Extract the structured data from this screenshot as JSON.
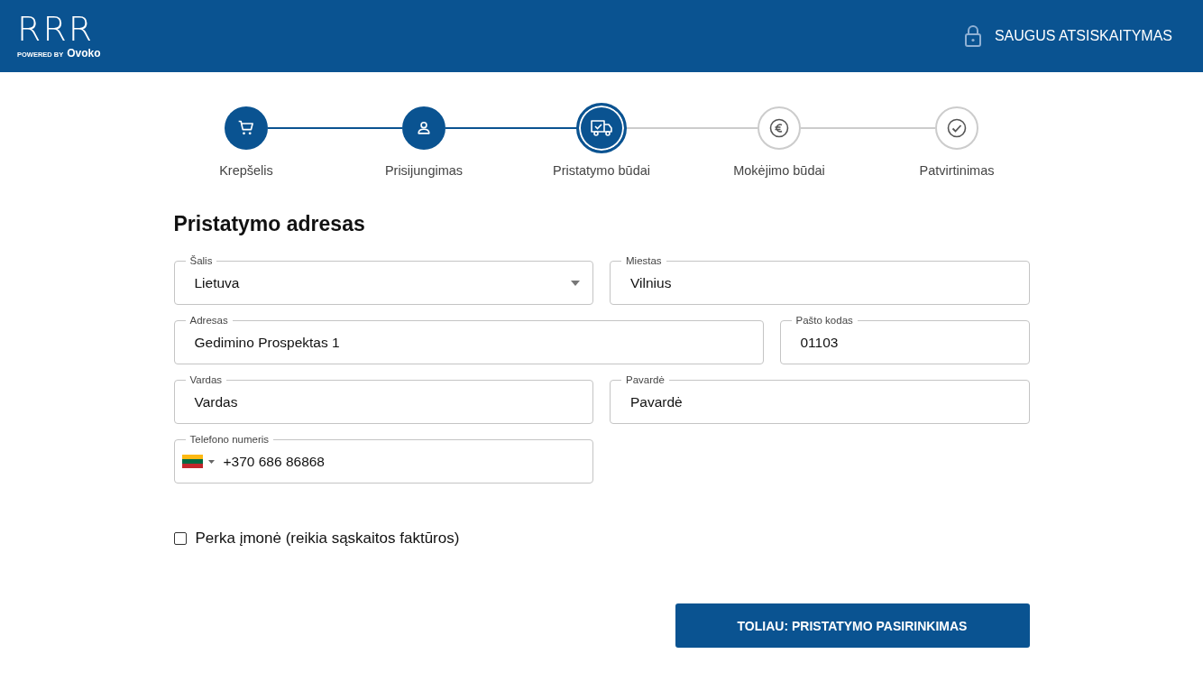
{
  "header": {
    "logo": "RRR",
    "powered_by": "POWERED BY",
    "brand": "Ovoko",
    "secure_label": "SAUGUS ATSISKAITYMAS"
  },
  "steps": [
    {
      "label": "Krepšelis",
      "kind": "done"
    },
    {
      "label": "Prisijungimas",
      "kind": "done"
    },
    {
      "label": "Pristatymo būdai",
      "kind": "current"
    },
    {
      "label": "Mokėjimo būdai",
      "kind": "todo"
    },
    {
      "label": "Patvirtinimas",
      "kind": "todo"
    }
  ],
  "form": {
    "title": "Pristatymo adresas",
    "rows": [
      [
        {
          "kind": "select",
          "label": "Šalis",
          "value": "Lietuva"
        },
        {
          "kind": "text",
          "label": "Miestas",
          "value": "Vilnius"
        }
      ],
      [
        {
          "kind": "text",
          "label": "Adresas",
          "value": "Gedimino Prospektas 1"
        },
        {
          "kind": "text",
          "label": "Pašto kodas",
          "value": "01103"
        }
      ],
      [
        {
          "kind": "text",
          "label": "Vardas",
          "value": "Vardas"
        },
        {
          "kind": "text",
          "label": "Pavardė",
          "value": "Pavardė"
        }
      ],
      [
        {
          "kind": "phone",
          "label": "Telefono numeris",
          "value": "+370 686 86868"
        }
      ]
    ],
    "company_checkbox": {
      "label": "Perka įmonė (reikia sąskaitos faktūros)",
      "checked": false
    },
    "next_button": "TOLIAU: PRISTATYMO PASIRINKIMAS"
  }
}
